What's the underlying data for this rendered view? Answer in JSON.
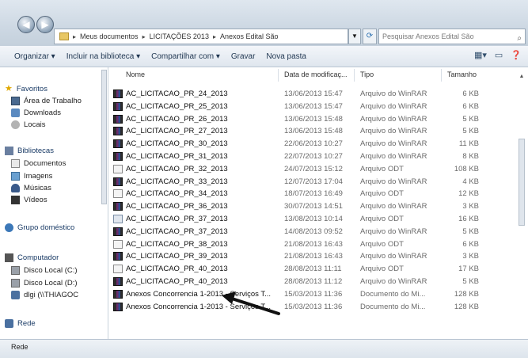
{
  "address": {
    "segments": [
      "Meus documentos",
      "LICITAÇÕES 2013",
      "Anexos Edital São"
    ],
    "search_placeholder": "Pesquisar Anexos Edital São"
  },
  "toolbar": {
    "organize": "Organizar ▾",
    "include": "Incluir na biblioteca ▾",
    "share": "Compartilhar com ▾",
    "burn": "Gravar",
    "new_folder": "Nova pasta"
  },
  "nav": {
    "favorites": "Favoritos",
    "desktop": "Área de Trabalho",
    "downloads": "Downloads",
    "recent": "Locais",
    "libraries": "Bibliotecas",
    "documents": "Documentos",
    "images": "Imagens",
    "music": "Músicas",
    "videos": "Vídeos",
    "homegroup": "Grupo doméstico",
    "computer": "Computador",
    "disk_c": "Disco Local (C:)",
    "disk_d": "Disco Local (D:)",
    "network_drive": "dlgi (\\\\THIAGOC",
    "network": "Rede"
  },
  "columns": {
    "name": "Nome",
    "date": "Data de modificaç...",
    "type": "Tipo",
    "size": "Tamanho"
  },
  "files": [
    {
      "name": "AC_LICITACAO_PR_24_2013",
      "date": "13/06/2013 15:47",
      "type": "Arquivo do WinRAR",
      "size": "6 KB",
      "icon": "rar"
    },
    {
      "name": "AC_LICITACAO_PR_25_2013",
      "date": "13/06/2013 15:47",
      "type": "Arquivo do WinRAR",
      "size": "6 KB",
      "icon": "rar"
    },
    {
      "name": "AC_LICITACAO_PR_26_2013",
      "date": "13/06/2013 15:48",
      "type": "Arquivo do WinRAR",
      "size": "5 KB",
      "icon": "rar"
    },
    {
      "name": "AC_LICITACAO_PR_27_2013",
      "date": "13/06/2013 15:48",
      "type": "Arquivo do WinRAR",
      "size": "5 KB",
      "icon": "rar"
    },
    {
      "name": "AC_LICITACAO_PR_30_2013",
      "date": "22/06/2013 10:27",
      "type": "Arquivo do WinRAR",
      "size": "11 KB",
      "icon": "rar"
    },
    {
      "name": "AC_LICITACAO_PR_31_2013",
      "date": "22/07/2013 10:27",
      "type": "Arquivo do WinRAR",
      "size": "8 KB",
      "icon": "rar"
    },
    {
      "name": "AC_LICITACAO_PR_32_2013",
      "date": "24/07/2013 15:12",
      "type": "Arquivo ODT",
      "size": "108 KB",
      "icon": "odt"
    },
    {
      "name": "AC_LICITACAO_PR_33_2013",
      "date": "12/07/2013 17:04",
      "type": "Arquivo do WinRAR",
      "size": "4 KB",
      "icon": "rar"
    },
    {
      "name": "AC_LICITACAO_PR_34_2013",
      "date": "18/07/2013 16:49",
      "type": "Arquivo ODT",
      "size": "12 KB",
      "icon": "odt"
    },
    {
      "name": "AC_LICITACAO_PR_36_2013",
      "date": "30/07/2013 14:51",
      "type": "Arquivo do WinRAR",
      "size": "3 KB",
      "icon": "rar"
    },
    {
      "name": "AC_LICITACAO_PR_37_2013",
      "date": "13/08/2013 10:14",
      "type": "Arquivo ODT",
      "size": "16 KB",
      "icon": "pdf"
    },
    {
      "name": "AC_LICITACAO_PR_37_2013",
      "date": "14/08/2013 09:52",
      "type": "Arquivo do WinRAR",
      "size": "5 KB",
      "icon": "rar"
    },
    {
      "name": "AC_LICITACAO_PR_38_2013",
      "date": "21/08/2013 16:43",
      "type": "Arquivo ODT",
      "size": "6 KB",
      "icon": "odt"
    },
    {
      "name": "AC_LICITACAO_PR_39_2013",
      "date": "21/08/2013 16:43",
      "type": "Arquivo do WinRAR",
      "size": "3 KB",
      "icon": "rar"
    },
    {
      "name": "AC_LICITACAO_PR_40_2013",
      "date": "28/08/2013 11:11",
      "type": "Arquivo ODT",
      "size": "17 KB",
      "icon": "odt"
    },
    {
      "name": "AC_LICITACAO_PR_40_2013",
      "date": "28/08/2013 11:12",
      "type": "Arquivo do WinRAR",
      "size": "5 KB",
      "icon": "rar"
    },
    {
      "name": "Anexos Concorrencia 1-2013 - Serviços T...",
      "date": "15/03/2013 11:36",
      "type": "Documento do Mi...",
      "size": "128 KB",
      "icon": "rar"
    },
    {
      "name": "Anexos Concorrencia 1-2013 - Serviços T...",
      "date": "15/03/2013 11:36",
      "type": "Documento do Mi...",
      "size": "128 KB",
      "icon": "rar"
    }
  ]
}
